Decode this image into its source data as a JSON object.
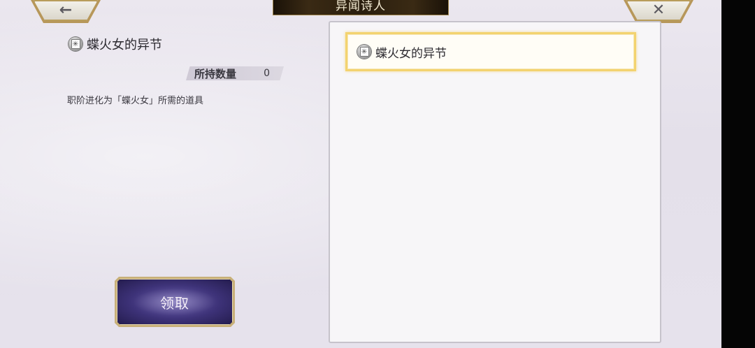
{
  "header": {
    "title": "异闻诗人",
    "back_icon": "←",
    "close_icon": "✕"
  },
  "detail": {
    "item_name": "蝶火女的异节",
    "quantity_label": "所持数量",
    "quantity_value": "0",
    "description": "职阶进化为「蝶火女」所需的道具",
    "claim_label": "领取"
  },
  "list": {
    "items": [
      {
        "name": "蝶火女的异节",
        "selected": true
      }
    ]
  },
  "colors": {
    "accent_gold": "#f3d36f",
    "button_purple": "#3d3278",
    "frame_gold": "#b7975a"
  }
}
